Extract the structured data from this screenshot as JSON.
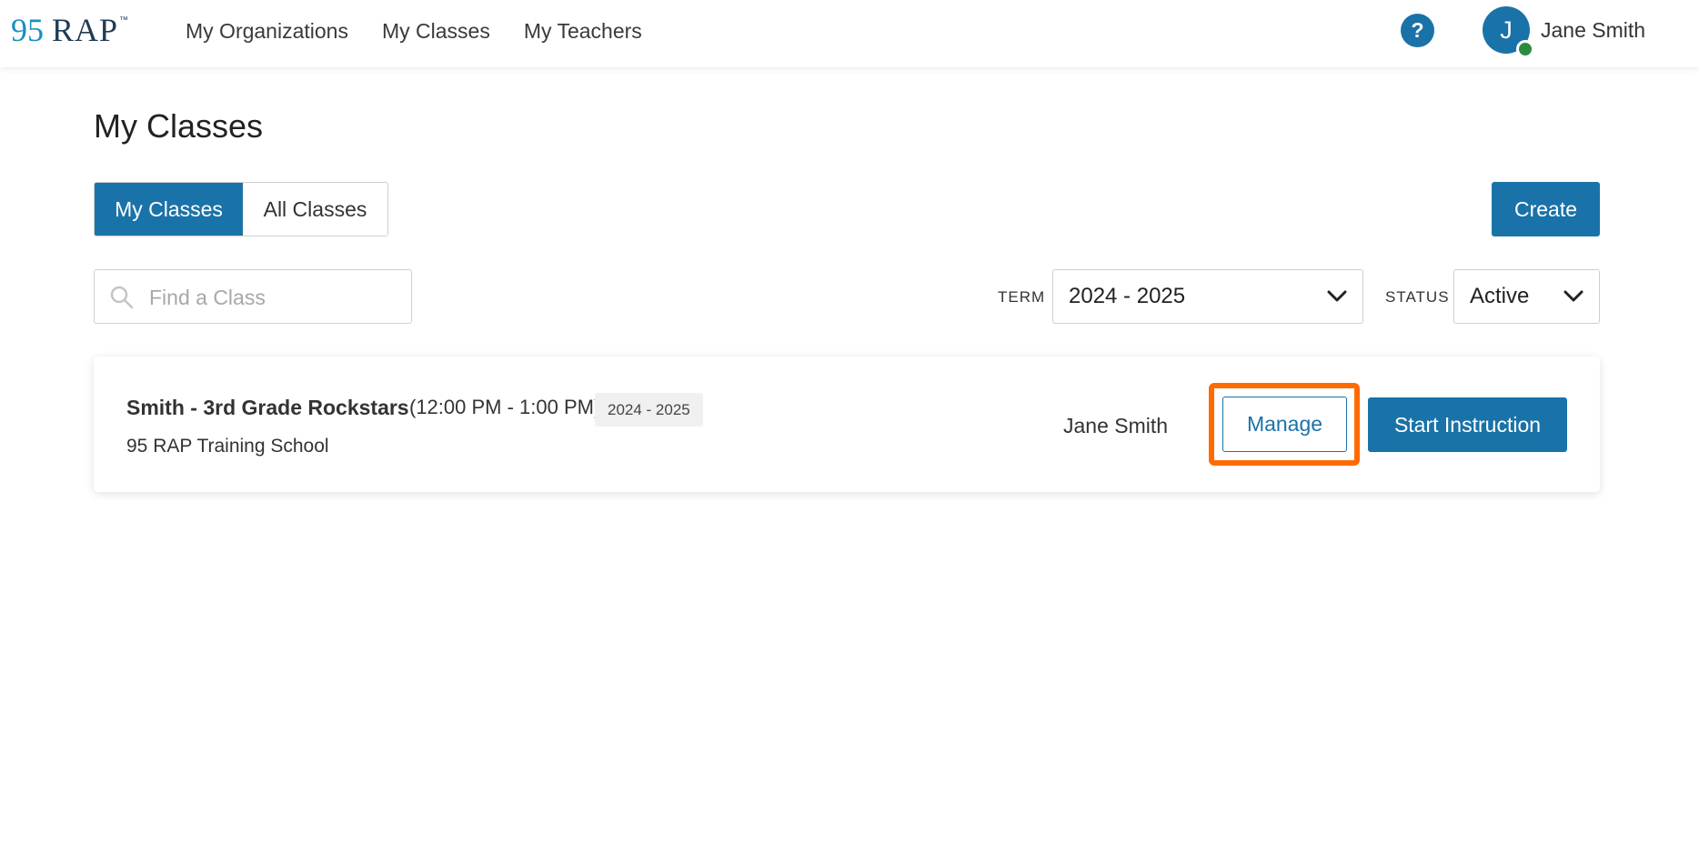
{
  "header": {
    "logo": {
      "num": "95",
      "word": "RAP",
      "tm": "™"
    },
    "nav": [
      "My Organizations",
      "My Classes",
      "My Teachers"
    ],
    "help_icon": "?",
    "avatar_initial": "J",
    "user_name": "Jane Smith"
  },
  "page": {
    "title": "My Classes",
    "toggle": {
      "my_classes": "My Classes",
      "all_classes": "All Classes",
      "selected": "My Classes"
    },
    "create_label": "Create",
    "search": {
      "placeholder": "Find a Class",
      "value": ""
    },
    "filters": {
      "term_label": "TERM",
      "term_value": "2024 - 2025",
      "status_label": "STATUS",
      "status_value": "Active"
    }
  },
  "classes": [
    {
      "name": "Smith - 3rd Grade Rockstars",
      "time": "(12:00 PM - 1:00 PM)",
      "term": "2024 - 2025",
      "school": "95 RAP Training School",
      "teacher": "Jane Smith",
      "manage_label": "Manage",
      "start_label": "Start Instruction"
    }
  ],
  "colors": {
    "primary": "#1a73a8",
    "highlight": "#ff6a00",
    "presence": "#2e8b3e"
  }
}
